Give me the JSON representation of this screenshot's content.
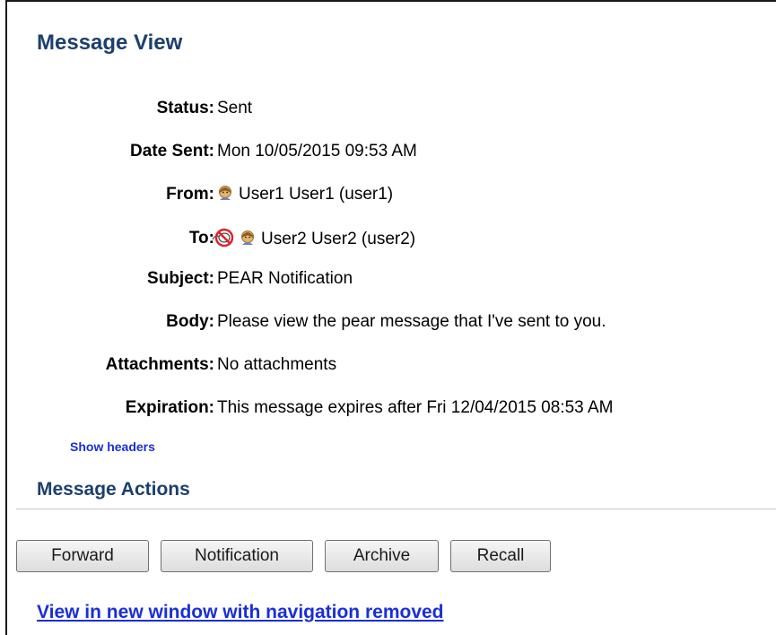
{
  "page": {
    "title": "Message View"
  },
  "fields": [
    {
      "label": "Status:",
      "value": "Sent"
    },
    {
      "label": "Date Sent:",
      "value": "Mon 10/05/2015 09:53 AM"
    },
    {
      "label": "From:",
      "value": "User1 User1 (user1)",
      "icon": "user-icon"
    },
    {
      "label": "To:",
      "value": "User2 User2 (user2)",
      "icons": [
        "not-read-icon",
        "user-icon"
      ]
    },
    {
      "label": "Subject:",
      "value": "PEAR Notification"
    },
    {
      "label": "Body:",
      "value": "Please view the pear message that I've sent to you."
    },
    {
      "label": "Attachments:",
      "value": "No attachments"
    },
    {
      "label": "Expiration:",
      "value": "This message expires after Fri 12/04/2015 08:53 AM"
    }
  ],
  "show_headers_label": "Show headers",
  "actions": {
    "title": "Message Actions",
    "buttons": {
      "forward": "Forward",
      "notification": "Notification",
      "archive": "Archive",
      "recall": "Recall"
    }
  },
  "new_window_link": "View in new window with navigation removed",
  "colors": {
    "heading": "#1c3f6e",
    "link": "#1a2fd6",
    "blocked": "#e0202a"
  }
}
